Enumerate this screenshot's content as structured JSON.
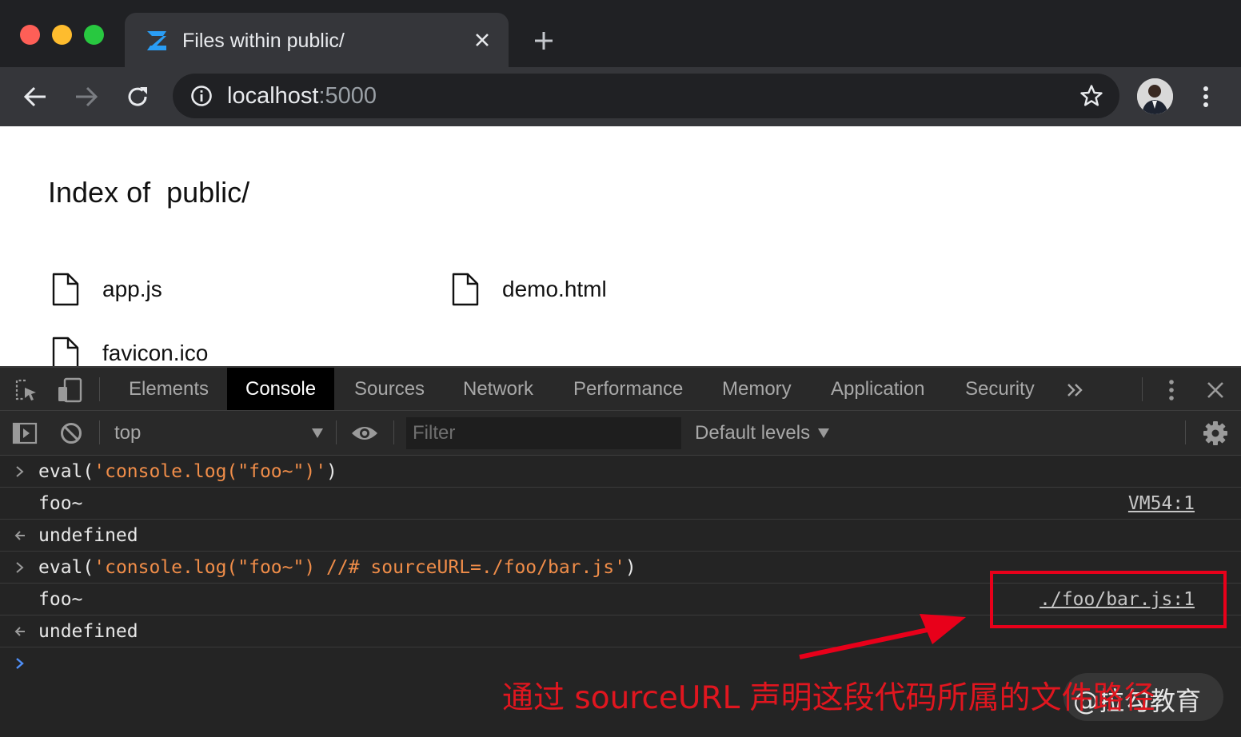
{
  "browser": {
    "tab_title": "Files within public/",
    "url_host": "localhost",
    "url_port": ":5000"
  },
  "page": {
    "title": "Index of  public/",
    "files": [
      {
        "name": "app.js"
      },
      {
        "name": "demo.html"
      },
      {
        "name": "favicon.ico"
      }
    ]
  },
  "devtools": {
    "tabs": [
      "Elements",
      "Console",
      "Sources",
      "Network",
      "Performance",
      "Memory",
      "Application",
      "Security"
    ],
    "active_tab": "Console",
    "context": "top",
    "filter_placeholder": "Filter",
    "levels": "Default levels",
    "console": [
      {
        "kind": "input",
        "fn": "eval(",
        "str": "'console.log(\"foo~\")'",
        "close": ")"
      },
      {
        "kind": "log",
        "text": "foo~",
        "source": "VM54:1"
      },
      {
        "kind": "result",
        "text": "undefined"
      },
      {
        "kind": "input",
        "fn": "eval(",
        "str": "'console.log(\"foo~\") //# sourceURL=./foo/bar.js'",
        "close": ")"
      },
      {
        "kind": "log",
        "text": "foo~",
        "source": "./foo/bar.js:1"
      },
      {
        "kind": "result",
        "text": "undefined"
      }
    ]
  },
  "annotation": {
    "caption": "通过 sourceURL 声明这段代码所属的文件路径",
    "watermark": "@拉勾教育",
    "color": "#e8001a"
  }
}
